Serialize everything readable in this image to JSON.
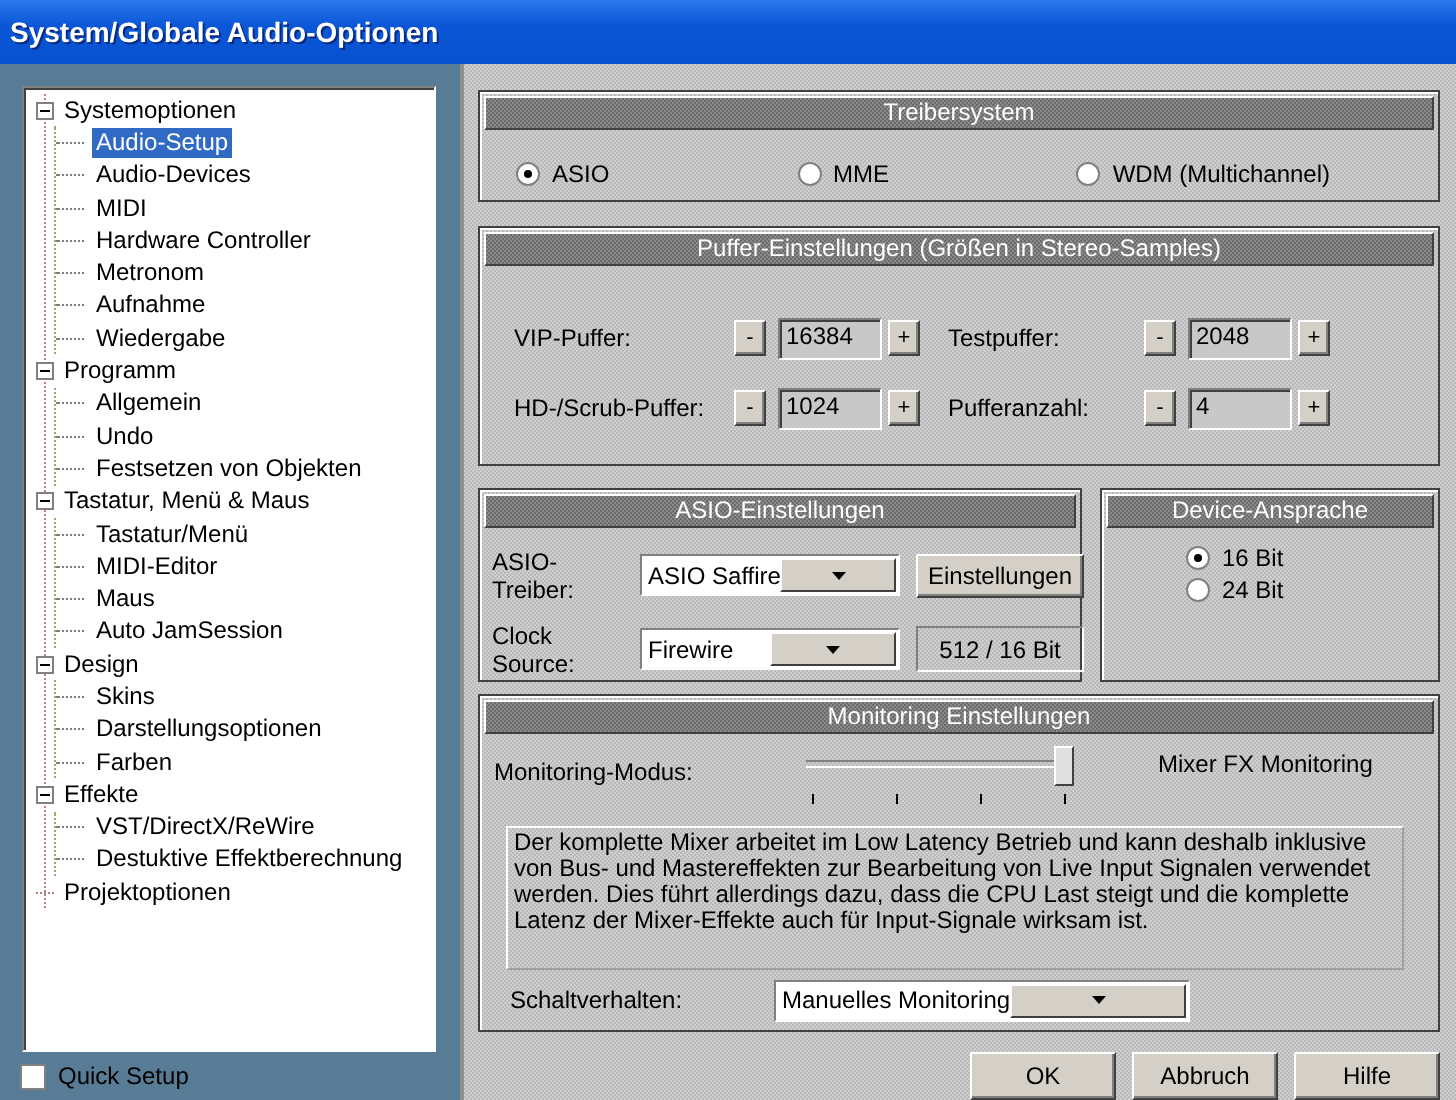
{
  "window": {
    "title": "System/Globale Audio-Optionen"
  },
  "tree": [
    {
      "label": "Systemoptionen",
      "expanded": true,
      "selected": false,
      "children": [
        {
          "label": "Audio-Setup",
          "selected": true
        },
        {
          "label": "Audio-Devices",
          "selected": false
        },
        {
          "label": "MIDI",
          "selected": false
        },
        {
          "label": "Hardware Controller",
          "selected": false
        },
        {
          "label": "Metronom",
          "selected": false
        },
        {
          "label": "Aufnahme",
          "selected": false
        },
        {
          "label": "Wiedergabe",
          "selected": false
        }
      ]
    },
    {
      "label": "Programm",
      "expanded": true,
      "selected": false,
      "children": [
        {
          "label": "Allgemein",
          "selected": false
        },
        {
          "label": "Undo",
          "selected": false
        },
        {
          "label": "Festsetzen von Objekten",
          "selected": false
        }
      ]
    },
    {
      "label": "Tastatur, Menü & Maus",
      "expanded": true,
      "selected": false,
      "children": [
        {
          "label": "Tastatur/Menü",
          "selected": false
        },
        {
          "label": "MIDI-Editor",
          "selected": false
        },
        {
          "label": "Maus",
          "selected": false
        },
        {
          "label": "Auto JamSession",
          "selected": false
        }
      ]
    },
    {
      "label": "Design",
      "expanded": true,
      "selected": false,
      "children": [
        {
          "label": "Skins",
          "selected": false
        },
        {
          "label": "Darstellungsoptionen",
          "selected": false
        },
        {
          "label": "Farben",
          "selected": false
        }
      ]
    },
    {
      "label": "Effekte",
      "expanded": true,
      "selected": false,
      "children": [
        {
          "label": "VST/DirectX/ReWire",
          "selected": false
        },
        {
          "label": "Destuktive Effektberechnung",
          "selected": false
        }
      ]
    },
    {
      "label": "Projektoptionen",
      "selected": false
    }
  ],
  "quick_setup": {
    "label": "Quick Setup",
    "checked": false
  },
  "treibersystem": {
    "title": "Treibersystem",
    "options": [
      {
        "label": "ASIO",
        "selected": true
      },
      {
        "label": "MME",
        "selected": false
      },
      {
        "label": "WDM (Multichannel)",
        "selected": false
      }
    ]
  },
  "puffer": {
    "title": "Puffer-Einstellungen (Größen in Stereo-Samples)",
    "fields": [
      {
        "label": "VIP-Puffer:",
        "minus": "-",
        "value": "16384",
        "plus": "+"
      },
      {
        "label": "Testpuffer:",
        "minus": "-",
        "value": "2048",
        "plus": "+"
      },
      {
        "label": "HD-/Scrub-Puffer:",
        "minus": "-",
        "value": "1024",
        "plus": "+"
      },
      {
        "label": "Pufferanzahl:",
        "minus": "-",
        "value": "4",
        "plus": "+"
      }
    ]
  },
  "asio": {
    "title": "ASIO-Einstellungen",
    "driver_label": "ASIO-Treiber:",
    "driver": "ASIO Saffire",
    "settings_button": "Einstellungen",
    "clock_label": "Clock Source:",
    "clock": "Firewire",
    "format": "512 / 16 Bit"
  },
  "device": {
    "title": "Device-Ansprache",
    "options": [
      {
        "label": "16 Bit",
        "selected": true
      },
      {
        "label": "24 Bit",
        "selected": false
      }
    ]
  },
  "monitoring": {
    "title": "Monitoring Einstellungen",
    "mode_label": "Monitoring-Modus:",
    "slider": {
      "level": 1
    },
    "mode_name": "Mixer FX Monitoring",
    "description": "Der komplette Mixer arbeitet im Low Latency Betrieb und kann deshalb inklusive von Bus- und Mastereffekten zur Bearbeitung von Live Input Signalen verwendet werden. Dies führt allerdings dazu, dass die CPU Last steigt und die komplette Latenz der Mixer-Effekte auch für Input-Signale wirksam ist.",
    "switch_label": "Schaltverhalten:",
    "switch_value": "Manuelles Monitoring"
  },
  "buttons": [
    "OK",
    "Abbruch",
    "Hilfe"
  ]
}
